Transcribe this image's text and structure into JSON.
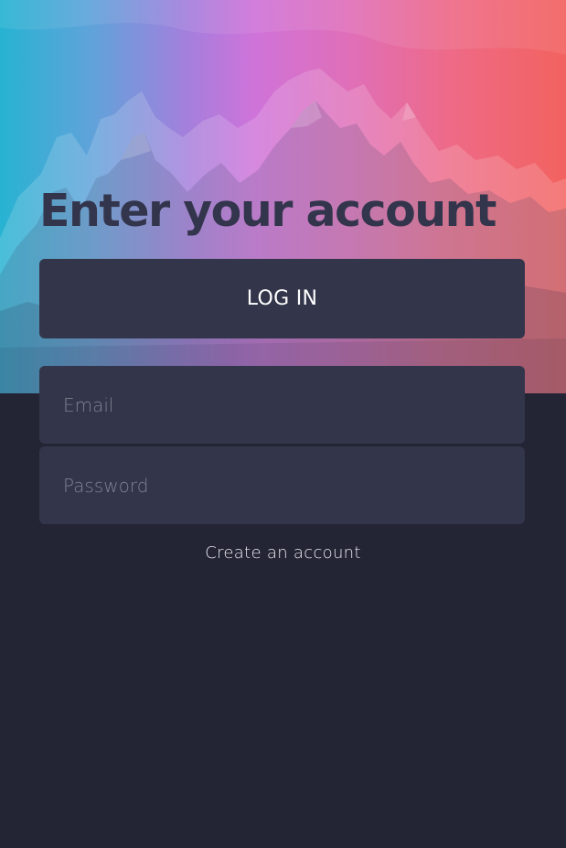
{
  "hero": {
    "headline": "Enter your account"
  },
  "login_button": {
    "label": "LOG IN"
  },
  "form": {
    "email": {
      "placeholder": "Email",
      "value": ""
    },
    "password": {
      "placeholder": "Password",
      "value": ""
    }
  },
  "footer": {
    "create_account_label": "Create an account"
  },
  "colors": {
    "background": "#232434",
    "panel": "#33354b",
    "headline": "#33354c",
    "gradient_left": "#27b3d2",
    "gradient_mid": "#cf73d9",
    "gradient_right": "#f2625f"
  }
}
